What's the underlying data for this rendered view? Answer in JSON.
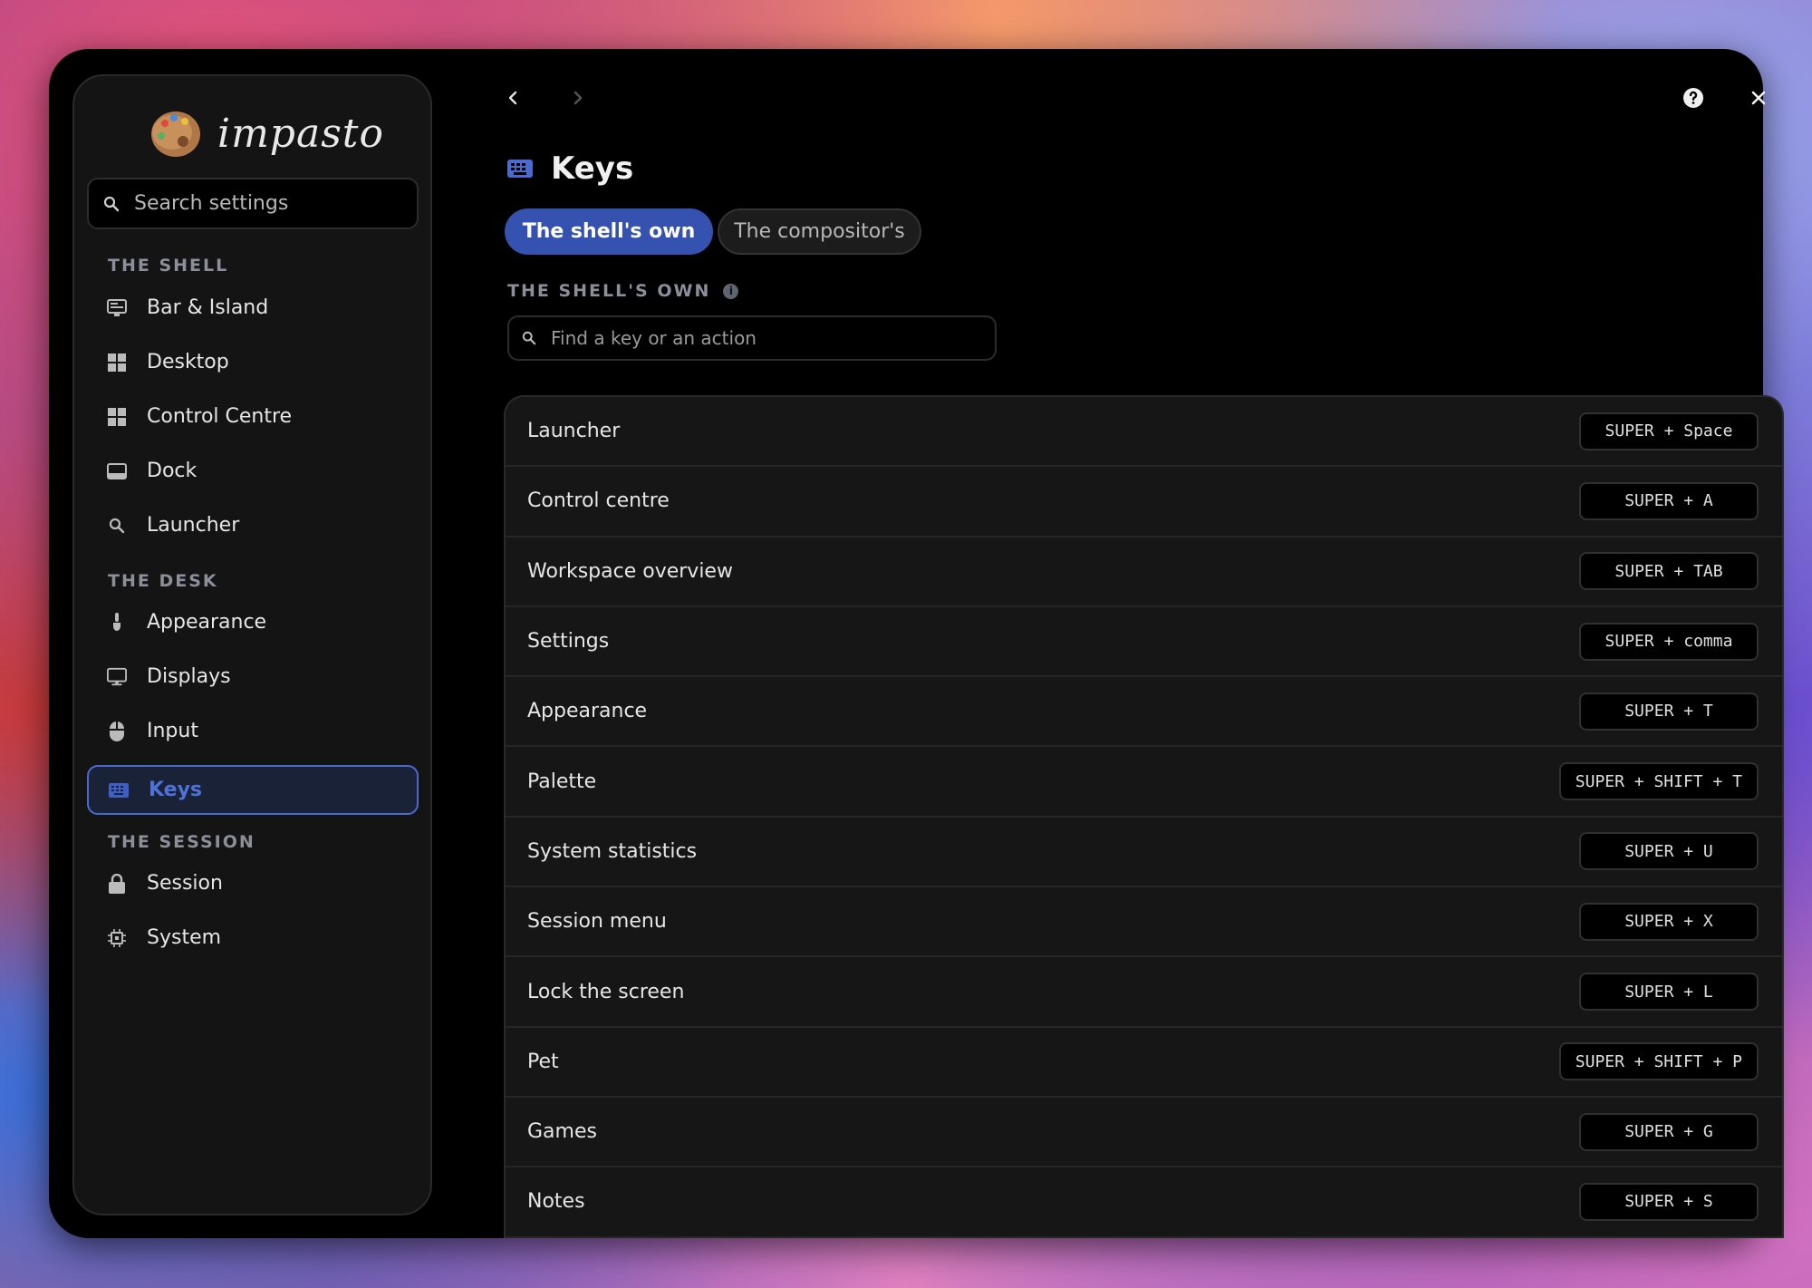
{
  "app": {
    "name": "impasto"
  },
  "sidebar": {
    "search_placeholder": "Search settings",
    "sections": [
      {
        "title": "THE SHELL"
      },
      {
        "title": "THE DESK"
      },
      {
        "title": "THE SESSION"
      }
    ],
    "items": [
      {
        "label": "Bar & Island",
        "icon": "bar-icon"
      },
      {
        "label": "Desktop",
        "icon": "grid-icon"
      },
      {
        "label": "Control Centre",
        "icon": "grid-icon"
      },
      {
        "label": "Dock",
        "icon": "dock-icon"
      },
      {
        "label": "Launcher",
        "icon": "search-icon"
      },
      {
        "label": "Appearance",
        "icon": "brush-icon"
      },
      {
        "label": "Displays",
        "icon": "monitor-icon"
      },
      {
        "label": "Input",
        "icon": "mouse-icon"
      },
      {
        "label": "Keys",
        "icon": "keyboard-icon",
        "active": true
      },
      {
        "label": "Session",
        "icon": "lock-icon"
      },
      {
        "label": "System",
        "icon": "chip-icon"
      }
    ]
  },
  "header": {
    "title": "Keys",
    "icon": "keyboard-icon"
  },
  "tabs": [
    {
      "label": "The shell's own",
      "active": true
    },
    {
      "label": "The compositor's",
      "active": false
    }
  ],
  "section": {
    "title": "THE SHELL'S OWN",
    "info_glyph": "i",
    "find_placeholder": "Find a key or an action"
  },
  "bindings": [
    {
      "action": "Launcher",
      "keys": "SUPER + Space"
    },
    {
      "action": "Control centre",
      "keys": "SUPER + A"
    },
    {
      "action": "Workspace overview",
      "keys": "SUPER + TAB"
    },
    {
      "action": "Settings",
      "keys": "SUPER + comma"
    },
    {
      "action": "Appearance",
      "keys": "SUPER + T"
    },
    {
      "action": "Palette",
      "keys": "SUPER + SHIFT + T"
    },
    {
      "action": "System statistics",
      "keys": "SUPER + U"
    },
    {
      "action": "Session menu",
      "keys": "SUPER + X"
    },
    {
      "action": "Lock the screen",
      "keys": "SUPER + L"
    },
    {
      "action": "Pet",
      "keys": "SUPER + SHIFT + P"
    },
    {
      "action": "Games",
      "keys": "SUPER + G"
    },
    {
      "action": "Notes",
      "keys": "SUPER + S"
    }
  ],
  "colors": {
    "accent": "#3552b0",
    "accent_text": "#4f72d8",
    "window_bg": "#000000",
    "panel_bg": "#161616"
  }
}
